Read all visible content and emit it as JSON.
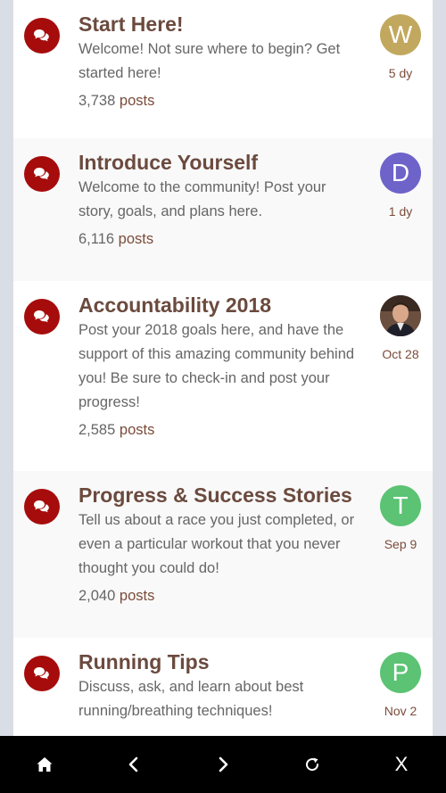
{
  "forums": [
    {
      "title": "Start Here!",
      "description": "Welcome! Not sure where to begin? Get started here!",
      "post_count": "3,738",
      "posts_label": "posts",
      "avatar_letter": "W",
      "avatar_color": "#c2a85e",
      "last_active": "5 dy"
    },
    {
      "title": "Introduce Yourself",
      "description": "Welcome to the community! Post your story, goals, and plans here.",
      "post_count": "6,116",
      "posts_label": "posts",
      "avatar_letter": "D",
      "avatar_color": "#6d63c9",
      "last_active": "1 dy"
    },
    {
      "title": "Accountability 2018",
      "description": "Post your 2018 goals here, and have the support of this amazing community behind you! Be sure to check-in and post your progress!",
      "post_count": "2,585",
      "posts_label": "posts",
      "avatar_letter": "",
      "avatar_color": "#5a4030",
      "last_active": "Oct 28"
    },
    {
      "title": "Progress & Success Stories",
      "description": "Tell us about a race you just completed, or even a particular workout that you never thought you could do!",
      "post_count": "2,040",
      "posts_label": "posts",
      "avatar_letter": "T",
      "avatar_color": "#5bc373",
      "last_active": "Sep 9"
    },
    {
      "title": "Running Tips",
      "description": "Discuss, ask, and learn about best running/breathing techniques!",
      "post_count": "",
      "posts_label": "",
      "avatar_letter": "P",
      "avatar_color": "#5bc373",
      "last_active": "Nov 2"
    }
  ],
  "colors": {
    "forum_icon_bg": "#a60c0c",
    "title": "#6b4a3e",
    "link": "#7b4c3a",
    "bottom_bar": "#000000"
  },
  "icons": {
    "forum": "chat-bubbles-icon",
    "home": "home-icon",
    "back": "chevron-left-icon",
    "forward": "chevron-right-icon",
    "reload": "reload-icon",
    "close": "close-icon"
  },
  "bottom_bar": {
    "close_label": "X"
  }
}
